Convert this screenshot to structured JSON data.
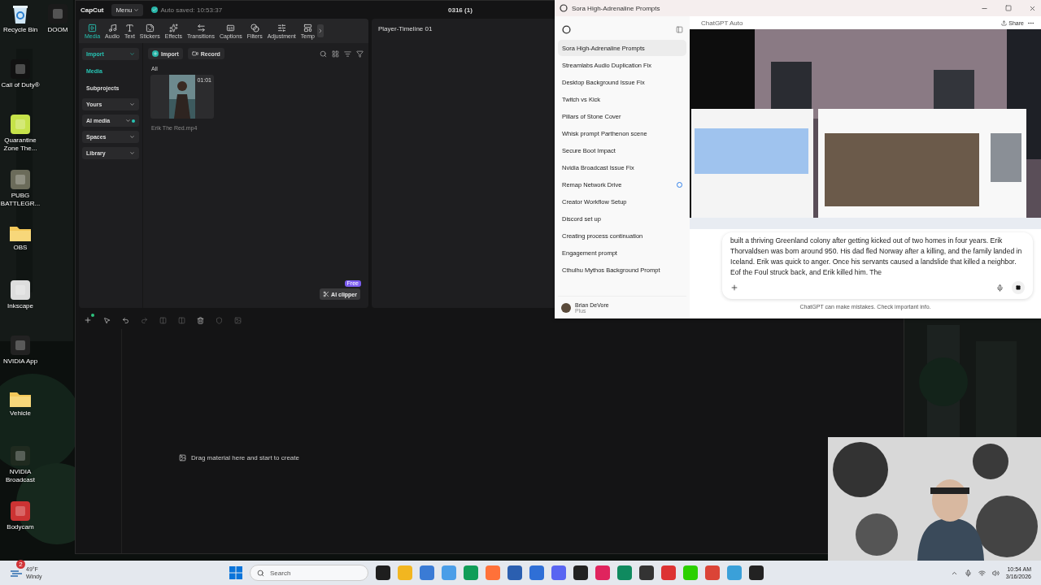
{
  "desktop_icons": [
    {
      "label": "Recycle Bin",
      "kind": "bin"
    },
    {
      "label": "DOOM",
      "kind": "app"
    },
    {
      "label": "Call of Duty®",
      "kind": "app"
    },
    {
      "label": "Quarantine Zone The...",
      "kind": "app"
    },
    {
      "label": "PUBG BATTLEGR...",
      "kind": "app"
    },
    {
      "label": "OBS",
      "kind": "folder"
    },
    {
      "label": "Inkscape",
      "kind": "app"
    },
    {
      "label": "NVIDIA App",
      "kind": "app"
    },
    {
      "label": "Vehicle",
      "kind": "folder"
    },
    {
      "label": "NVIDIA Broadcast",
      "kind": "app"
    },
    {
      "label": "Bodycam",
      "kind": "app"
    }
  ],
  "capcut": {
    "logo": "CapCut",
    "menu": "Menu",
    "autosave": "Auto saved: 10:53:37",
    "title": "0316 (1)",
    "tabs": [
      {
        "label": "Media",
        "selected": true
      },
      {
        "label": "Audio",
        "selected": false
      },
      {
        "label": "Text",
        "selected": false
      },
      {
        "label": "Stickers",
        "selected": false
      },
      {
        "label": "Effects",
        "selected": false
      },
      {
        "label": "Transitions",
        "selected": false
      },
      {
        "label": "Captions",
        "selected": false
      },
      {
        "label": "Filters",
        "selected": false
      },
      {
        "label": "Adjustment",
        "selected": false
      },
      {
        "label": "Temp",
        "selected": false
      }
    ],
    "nav": [
      {
        "label": "Import",
        "kind": "section",
        "selected": true,
        "new": false
      },
      {
        "label": "Media",
        "kind": "link",
        "selected": true,
        "new": false
      },
      {
        "label": "Subprojects",
        "kind": "link",
        "selected": false,
        "new": false
      },
      {
        "label": "Yours",
        "kind": "section",
        "selected": false,
        "new": false
      },
      {
        "label": "AI media",
        "kind": "section",
        "selected": false,
        "new": true
      },
      {
        "label": "Spaces",
        "kind": "section",
        "selected": false,
        "new": false
      },
      {
        "label": "Library",
        "kind": "section",
        "selected": false,
        "new": false
      }
    ],
    "import_button": "Import",
    "record_button": "Record",
    "filter": "All",
    "clips": [
      {
        "duration": "01:01",
        "name": "Erik The Red.mp4"
      }
    ],
    "ai_clipper": {
      "label": "AI clipper",
      "badge": "Free"
    },
    "player_title": "Player-Timeline 01",
    "timeline_hint": "Drag material here and start to create"
  },
  "chatgpt": {
    "window_title": "Sora High-Adrenaline Prompts",
    "chats": [
      {
        "title": "Sora High-Adrenaline Prompts",
        "selected": true,
        "pending": false
      },
      {
        "title": "Streamlabs Audio Duplication Fix",
        "selected": false,
        "pending": false
      },
      {
        "title": "Desktop Background Issue Fix",
        "selected": false,
        "pending": false
      },
      {
        "title": "Twitch vs Kick",
        "selected": false,
        "pending": false
      },
      {
        "title": "Pillars of Stone Cover",
        "selected": false,
        "pending": false
      },
      {
        "title": "Whisk prompt Parthenon scene",
        "selected": false,
        "pending": false
      },
      {
        "title": "Secure Boot Impact",
        "selected": false,
        "pending": false
      },
      {
        "title": "Nvidia Broadcast Issue Fix",
        "selected": false,
        "pending": false
      },
      {
        "title": "Remap Network Drive",
        "selected": false,
        "pending": true
      },
      {
        "title": "Creator Workflow Setup",
        "selected": false,
        "pending": false
      },
      {
        "title": "Discord set up",
        "selected": false,
        "pending": false
      },
      {
        "title": "Creating process continuation",
        "selected": false,
        "pending": false
      },
      {
        "title": "Engagement prompt",
        "selected": false,
        "pending": false
      },
      {
        "title": "Cthulhu Mythos Background Prompt",
        "selected": false,
        "pending": false
      }
    ],
    "user": {
      "name": "Brian DeVore",
      "plan": "Plus"
    },
    "model": "ChatGPT Auto",
    "share": "Share",
    "composer_text": "built a thriving Greenland colony after getting kicked out of two homes in four years. Erik Thorvaldsen was born around 950. His dad fled Norway after a killing, and the family landed in Iceland. Erik was quick to anger. Once his servants caused a landslide that killed a neighbor. Eof the Foul struck back, and Erik killed him. The",
    "disclaimer": "ChatGPT can make mistakes. Check important info."
  },
  "taskbar": {
    "weather": {
      "temp": "49°F",
      "condition": "Windy",
      "badge": "2"
    },
    "search": {
      "placeholder": "Search"
    },
    "time": "10:54 AM",
    "date": "3/16/2026"
  }
}
